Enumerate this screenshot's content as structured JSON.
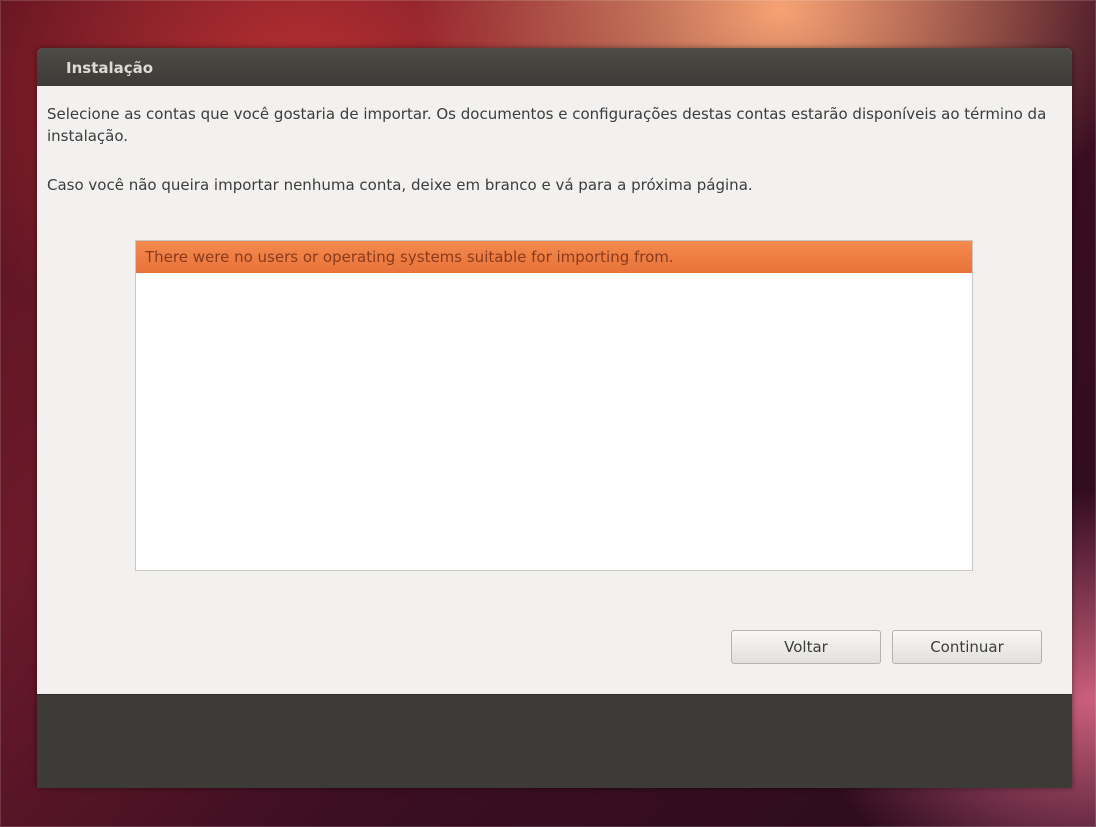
{
  "window": {
    "title": "Instalação"
  },
  "content": {
    "paragraph1": "Selecione as contas que você gostaria de importar. Os documentos e configurações destas contas estarão disponíveis ao término da instalação.",
    "paragraph2": "Caso você não queira importar nenhuma conta, deixe em branco e vá para a próxima página."
  },
  "accounts_list": {
    "rows": [
      "There were no users or operating systems suitable for importing from."
    ]
  },
  "buttons": {
    "back_label": "Voltar",
    "continue_label": "Continuar"
  },
  "colors": {
    "selection": "#e9733a",
    "titlebar": "#3c3b37",
    "dialog_background": "#f2f1f0"
  }
}
